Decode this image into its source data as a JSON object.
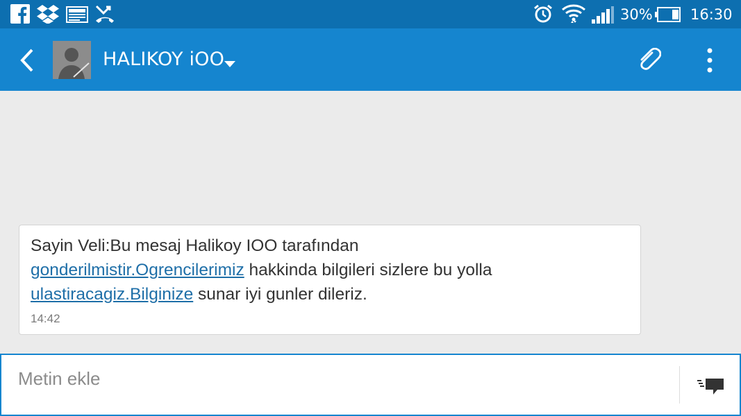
{
  "status_bar": {
    "battery": "30%",
    "time": "16:30",
    "notification_icons": [
      "facebook-icon",
      "dropbox-icon",
      "gallery-icon",
      "missed-call-icon"
    ],
    "system_icons": [
      "alarm-icon",
      "wifi-icon",
      "signal-icon",
      "battery-icon"
    ]
  },
  "header": {
    "contact_name": "HALIKOY iOO",
    "icons": [
      "back-icon",
      "avatar",
      "dropdown-arrow-icon",
      "attach-icon",
      "overflow-menu-icon"
    ]
  },
  "message": {
    "line1": "Sayin Veli:Bu mesaj Halikoy IOO tarafından",
    "link1": "gonderilmistir.Ogrencilerimiz",
    "text2": " hakkinda bilgileri sizlere bu yolla",
    "link2": "ulastiracagiz.Bilginize",
    "text3": " sunar iyi gunler dileriz.",
    "time": "14:42"
  },
  "compose": {
    "placeholder": "Metin ekle",
    "send_icon": "send-message-icon"
  },
  "colors": {
    "status_bar": "#0d6fb0",
    "action_bar": "#1585cf",
    "background": "#ebebeb",
    "link": "#1f6fa8"
  }
}
